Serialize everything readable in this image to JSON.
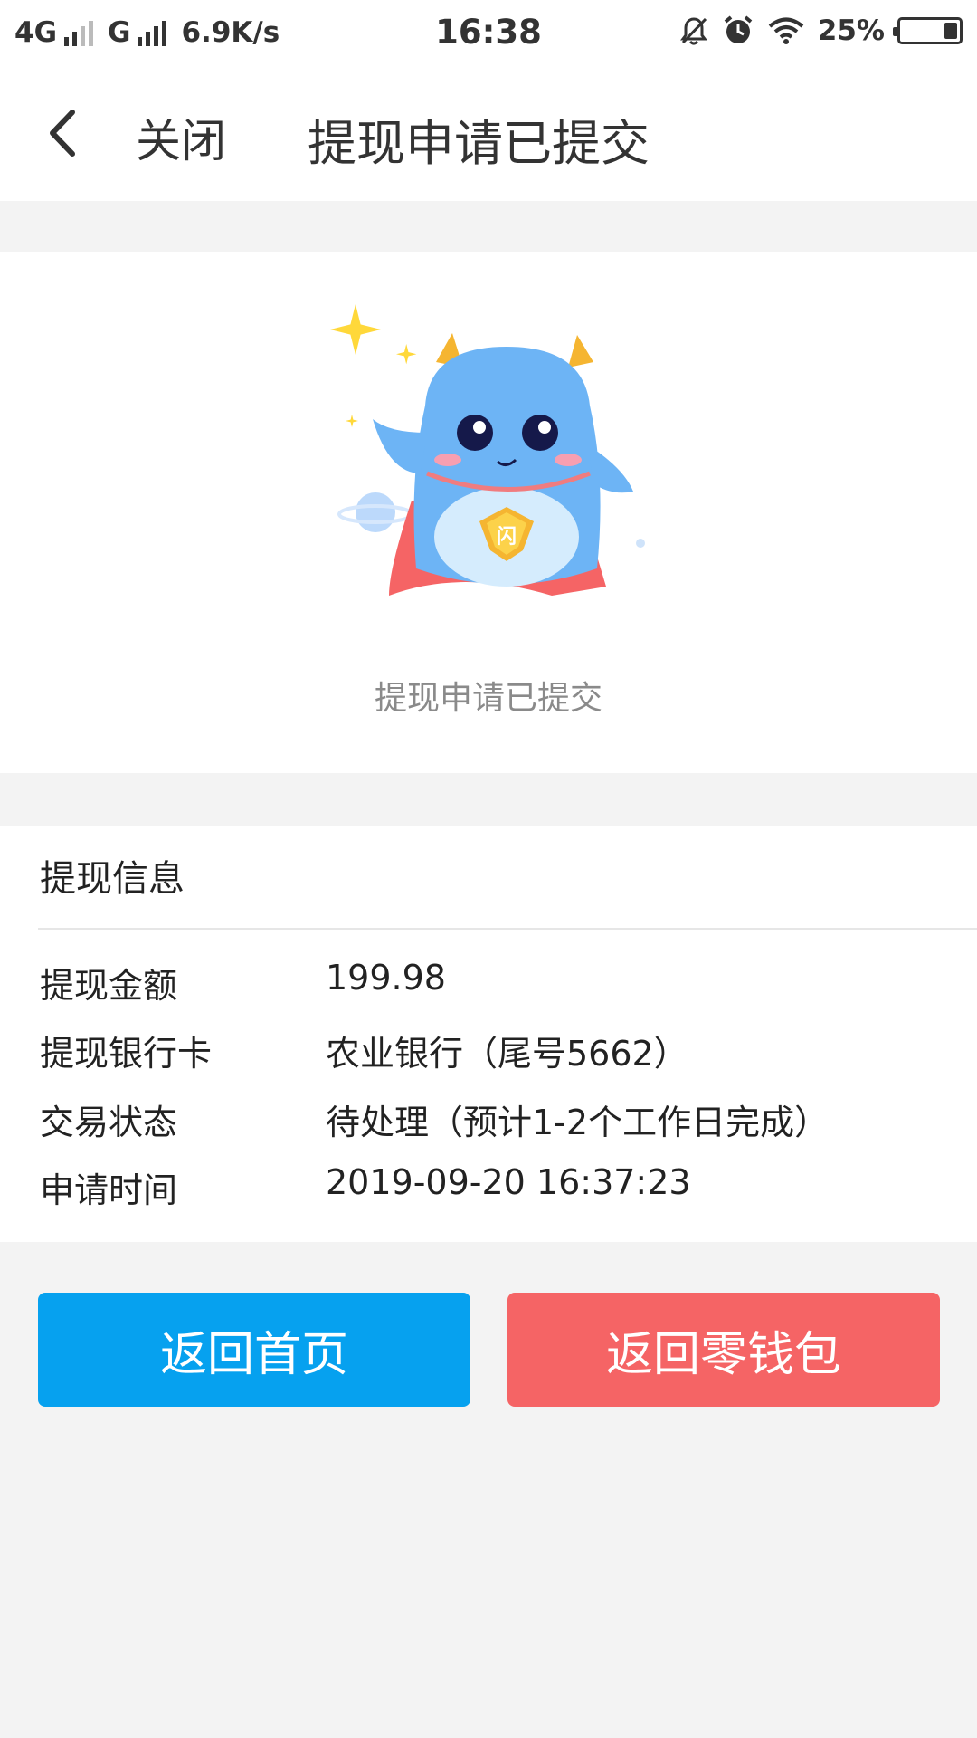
{
  "status_bar": {
    "network_1": "4G",
    "network_2": "G",
    "speed": "6.9K/s",
    "time": "16:38",
    "battery": "25%",
    "icons": [
      "signal-icon",
      "mute-bell-icon",
      "alarm-icon",
      "wifi-icon",
      "battery-icon"
    ]
  },
  "header": {
    "back_icon": "chevron-left-icon",
    "close_label": "关闭",
    "title": "提现申请已提交"
  },
  "hero": {
    "mascot_badge": "闪",
    "message": "提现申请已提交"
  },
  "info": {
    "title": "提现信息",
    "rows": [
      {
        "label": "提现金额",
        "value": "199.98"
      },
      {
        "label": "提现银行卡",
        "value": "农业银行（尾号5662）"
      },
      {
        "label": "交易状态",
        "value": "待处理（预计1-2个工作日完成）"
      },
      {
        "label": "申请时间",
        "value": "2019-09-20 16:37:23"
      }
    ]
  },
  "buttons": {
    "home_label": "返回首页",
    "wallet_label": "返回零钱包"
  },
  "colors": {
    "primary_blue": "#06a1ef",
    "accent_red": "#f56465",
    "page_bg": "#f3f3f3",
    "muted_text": "#8a8a8a"
  }
}
